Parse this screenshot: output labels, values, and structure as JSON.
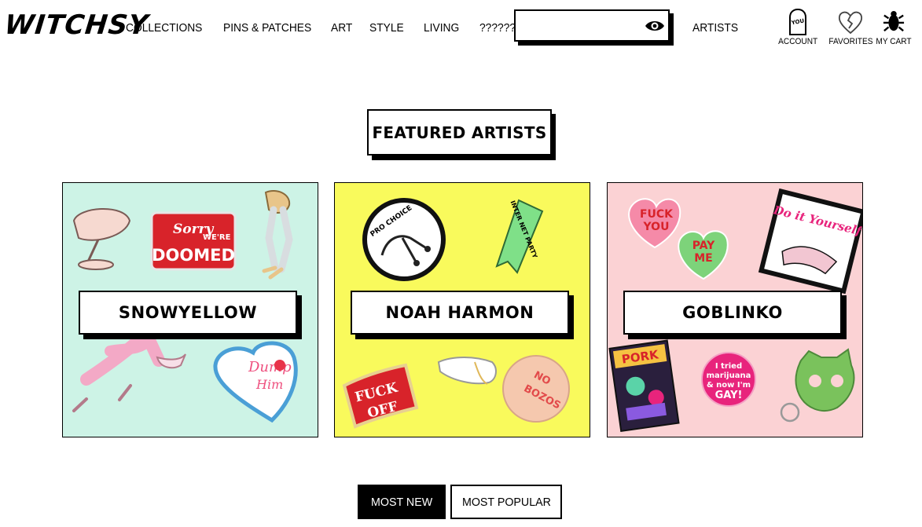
{
  "header": {
    "logo": "WITCHSY",
    "nav": [
      "COLLECTIONS",
      "PINS & PATCHES",
      "ART",
      "STYLE",
      "LIVING",
      "??????"
    ],
    "search": {
      "value": "",
      "placeholder": ""
    },
    "artists_link": "ARTISTS",
    "utility": {
      "account": "ACCOUNT",
      "favorites": "FAVORITES",
      "cart": "MY CART"
    }
  },
  "featured": {
    "title": "FEATURED ARTISTS",
    "artists": [
      {
        "name": "SNOWYELLOW",
        "bg": "#cdf3e6"
      },
      {
        "name": "NOAH HARMON",
        "bg": "#f9fa5c"
      },
      {
        "name": "GOBLINKO",
        "bg": "#fbd2d4"
      }
    ]
  },
  "artwork_text": {
    "doomed_1": "Sorry",
    "doomed_2": "WE'RE",
    "doomed_3": "DOOMED",
    "dump_1": "Dump",
    "dump_2": "Him",
    "pro_choice": "PRO CHOICE",
    "internet": "INTER NET PARTY",
    "fuck_off_1": "FUCK",
    "fuck_off_2": "OFF",
    "no_bozos_1": "NO",
    "no_bozos_2": "BOZOS",
    "heart_1_a": "FUCK",
    "heart_1_b": "YOU",
    "heart_2_a": "PAY",
    "heart_2_b": "ME",
    "diy": "Do it Yourself",
    "pork": "PORK",
    "button_1": "I tried",
    "button_2": "marijuana",
    "button_3": "& now I'm",
    "button_4": "GAY!"
  },
  "sort_tabs": [
    {
      "label": "MOST NEW",
      "active": true
    },
    {
      "label": "MOST POPULAR",
      "active": false
    }
  ],
  "colors": {
    "accent": "#000000",
    "doomed_red": "#d8232a",
    "heart_pink": "#f58aa8",
    "heart_green": "#7dd37a",
    "button_pink": "#e8247c"
  }
}
